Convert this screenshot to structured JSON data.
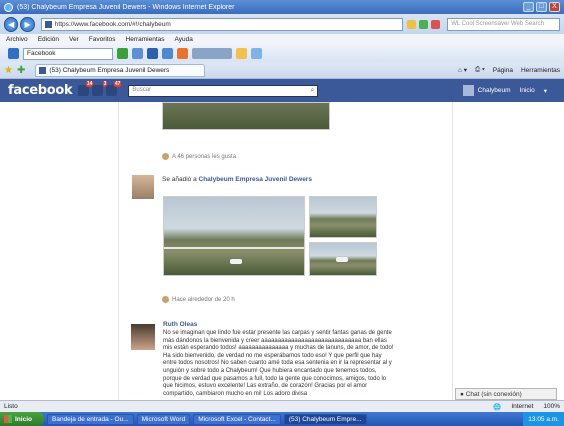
{
  "window": {
    "title": "(53) Chalybeum Empresa Juvenil Dewers - Windows Internet Explorer",
    "controls": [
      "_",
      "□",
      "X"
    ]
  },
  "address_bar": {
    "url": "https://www.facebook.com/#!/chalybeum",
    "search_placeholder": "WL Cool Screensaver Web Search"
  },
  "menu": [
    "Archivo",
    "Edición",
    "Ver",
    "Favoritos",
    "Herramientas",
    "Ayuda"
  ],
  "toolbar": {
    "search_value": "Facebook"
  },
  "tab": {
    "label": "(53) Chalybeum Empresa Juvenil Dewers",
    "commands": [
      "Página",
      "Herramientas"
    ]
  },
  "facebook": {
    "logo": "facebook",
    "jewels": [
      {
        "name": "friend-requests",
        "count": "14"
      },
      {
        "name": "messages",
        "count": "3"
      },
      {
        "name": "notifications",
        "count": "47"
      }
    ],
    "search_placeholder": "Buscar",
    "user_name": "Chalybeum",
    "home_label": "Inicio"
  },
  "feed": {
    "post1_meta": "A 46 personas les gusta",
    "post2_header_prefix": "Se añadió a",
    "post2_header_link": "Chalybeum Empresa Juvenil Dewers",
    "post2_meta": "Hace alrededor de 20 h",
    "comment": {
      "author": "Ruth Oleas",
      "text": "No se imaginan que lindo fue estar presente las carpas y sentir fantas ganas de gente más dándonos la bienvenida y creer aaaaaaaaaaaaaaaaaaaaaaaaaaaaaa ban ellas mis están esperando todos! aaaaaaaaaaaaaaa y muchas de lanuns, de amor, de todo! Ha sido bienvenido, de verdad no me esperábamos todo eso! Y que perfil que hay entre todos nosotros! No saben cuanto amé toda esa sentenia en ir la representar al y unguión y sobre todo a Chalybeum! Que hubiera encantado que tenemos todos, porque de verdad que pasamos a full, todo la gente que conocimos, amigos, todo lo que hicimos, estuvo excelente! Las extraño, de corazón! Gracias por el amor compartido, cambiaron mucho en mi! Los adoro divisa"
    }
  },
  "chat": {
    "label": "Chat (sin conexión)"
  },
  "status": {
    "left": "Listo",
    "zone": "Internet",
    "zoom": "100%"
  },
  "taskbar": {
    "start": "Inicio",
    "tasks": [
      {
        "label": "Bandeja de entrada - Ou..."
      },
      {
        "label": "Microsoft Word"
      },
      {
        "label": "Microsoft Excel - Contact..."
      },
      {
        "label": "(53) Chalybeum Empre..."
      }
    ],
    "clock": "13:05 a.m."
  }
}
